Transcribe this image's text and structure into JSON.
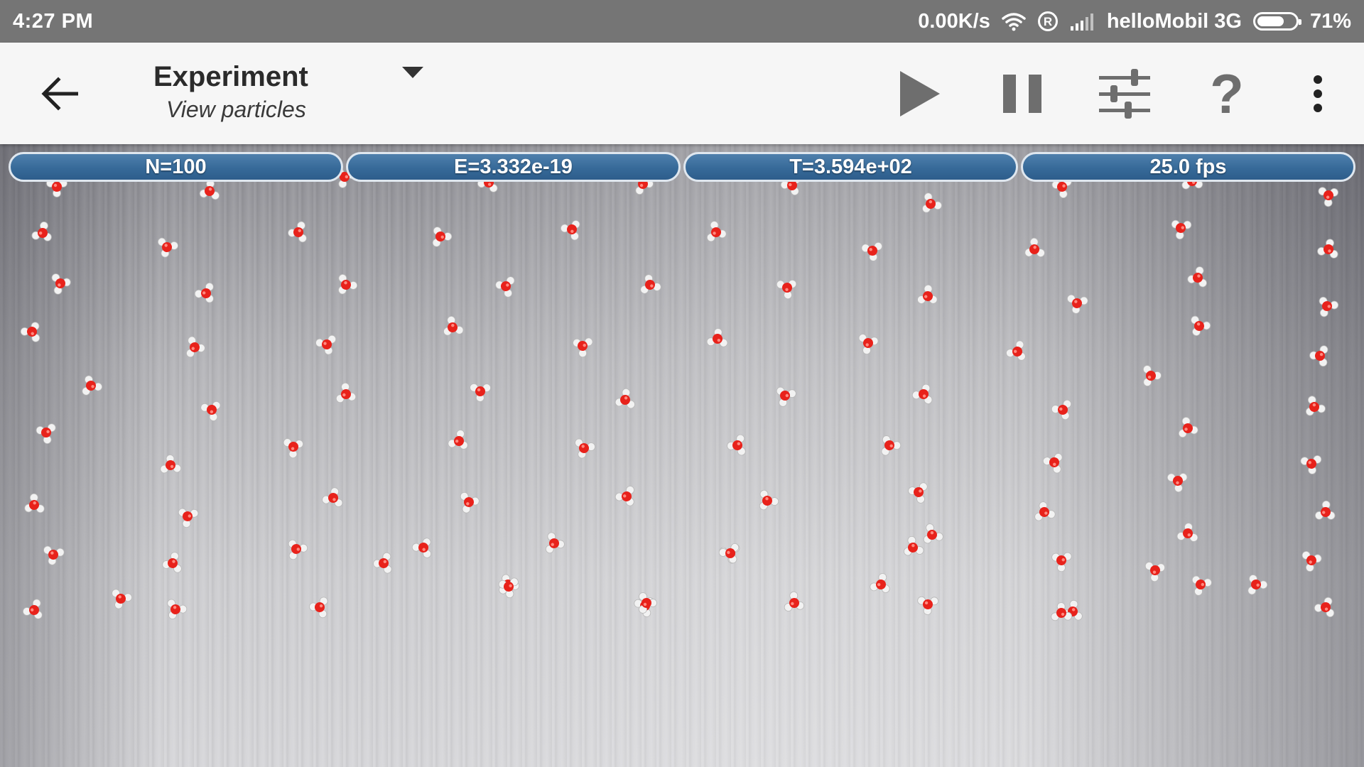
{
  "status_bar": {
    "time": "4:27 PM",
    "network_speed": "0.00K/s",
    "roaming_icon": "R",
    "carrier": "helloMobil 3G",
    "battery_percent": "71%",
    "battery_level": 0.71
  },
  "app_bar": {
    "title": "Experiment",
    "subtitle": "View particles",
    "help_label": "?",
    "icons": [
      "arrow-back-icon",
      "dropdown-triangle-icon",
      "play-icon",
      "pause-icon",
      "sliders-icon",
      "help-icon",
      "more-vert-icon"
    ]
  },
  "stats": {
    "n": "N=100",
    "energy": "E=3.332e-19",
    "temperature": "T=3.594e+02",
    "fps": "25.0 fps"
  },
  "colors": {
    "status_bar": "#757575",
    "app_bar": "#f6f6f6",
    "pill": "#376a99",
    "oxygen": "#e8221b",
    "hydrogen": "#f2f2f2"
  },
  "particle_count": 100
}
